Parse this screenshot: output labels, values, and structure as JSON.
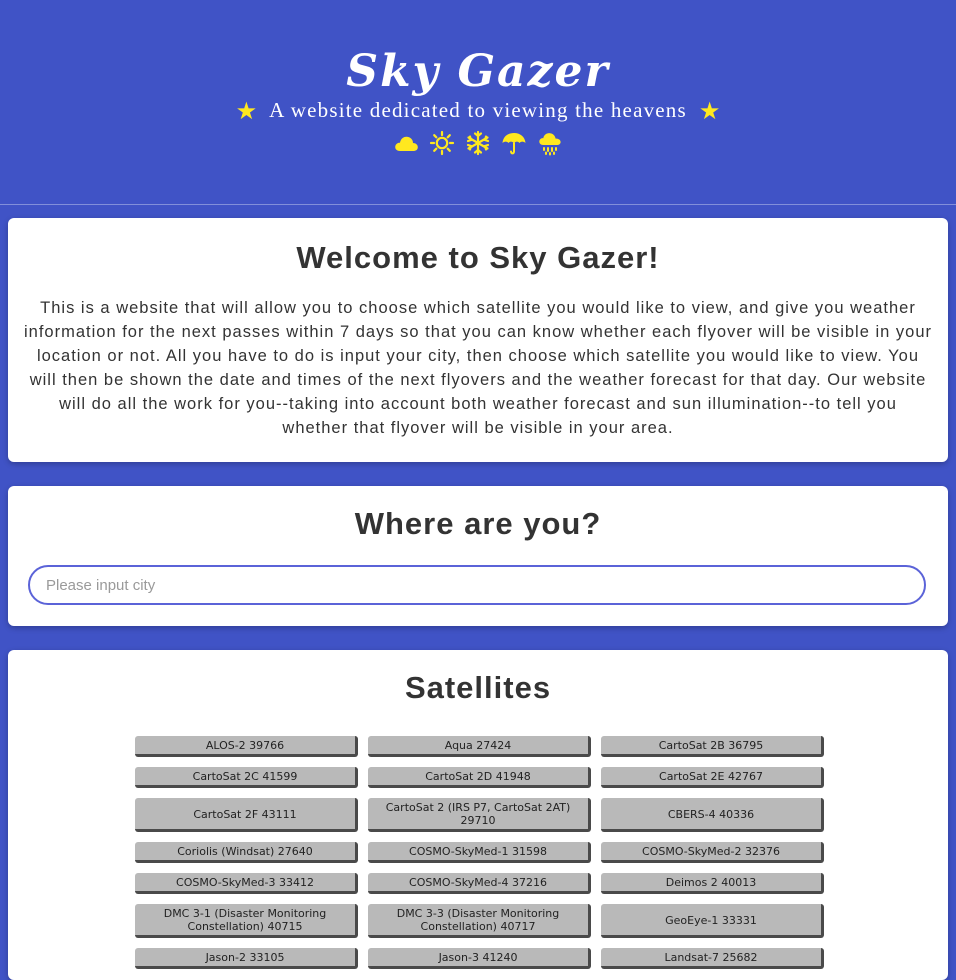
{
  "header": {
    "title": "Sky Gazer",
    "tagline": "A website dedicated to viewing the heavens",
    "accent_color": "#ffe81f",
    "background_color": "#4053c6",
    "weather_icons": [
      "cloud-icon",
      "sun-icon",
      "snowflake-icon",
      "umbrella-icon",
      "rain-cloud-icon"
    ]
  },
  "welcome": {
    "heading": "Welcome to Sky Gazer!",
    "body": "This is a website that will allow you to choose which satellite you would like to view, and give you weather information for the next passes within 7 days so that you can know whether each flyover will be visible in your location or not. All you have to do is input your city, then choose which satellite you would like to view. You will then be shown the date and times of the next flyovers and the weather forecast for that day. Our website will do all the work for you--taking into account both weather forecast and sun illumination--to tell you whether that flyover will be visible in your area."
  },
  "location": {
    "heading": "Where are you?",
    "city_value": "",
    "city_placeholder": "Please input city"
  },
  "satellites": {
    "heading": "Satellites",
    "items": [
      "ALOS-2 39766",
      "Aqua 27424",
      "CartoSat 2B 36795",
      "CartoSat 2C 41599",
      "CartoSat 2D 41948",
      "CartoSat 2E 42767",
      "CartoSat 2F 43111",
      "CartoSat 2 (IRS P7, CartoSat 2AT) 29710",
      "CBERS-4 40336",
      "Coriolis (Windsat) 27640",
      "COSMO-SkyMed-1 31598",
      "COSMO-SkyMed-2 32376",
      "COSMO-SkyMed-3 33412",
      "COSMO-SkyMed-4 37216",
      "Deimos 2 40013",
      "DMC 3-1 (Disaster Monitoring Constellation) 40715",
      "DMC 3-3 (Disaster Monitoring Constellation) 40717",
      "GeoEye-1 33331",
      "Jason-2 33105",
      "Jason-3 41240",
      "Landsat-7 25682"
    ]
  }
}
